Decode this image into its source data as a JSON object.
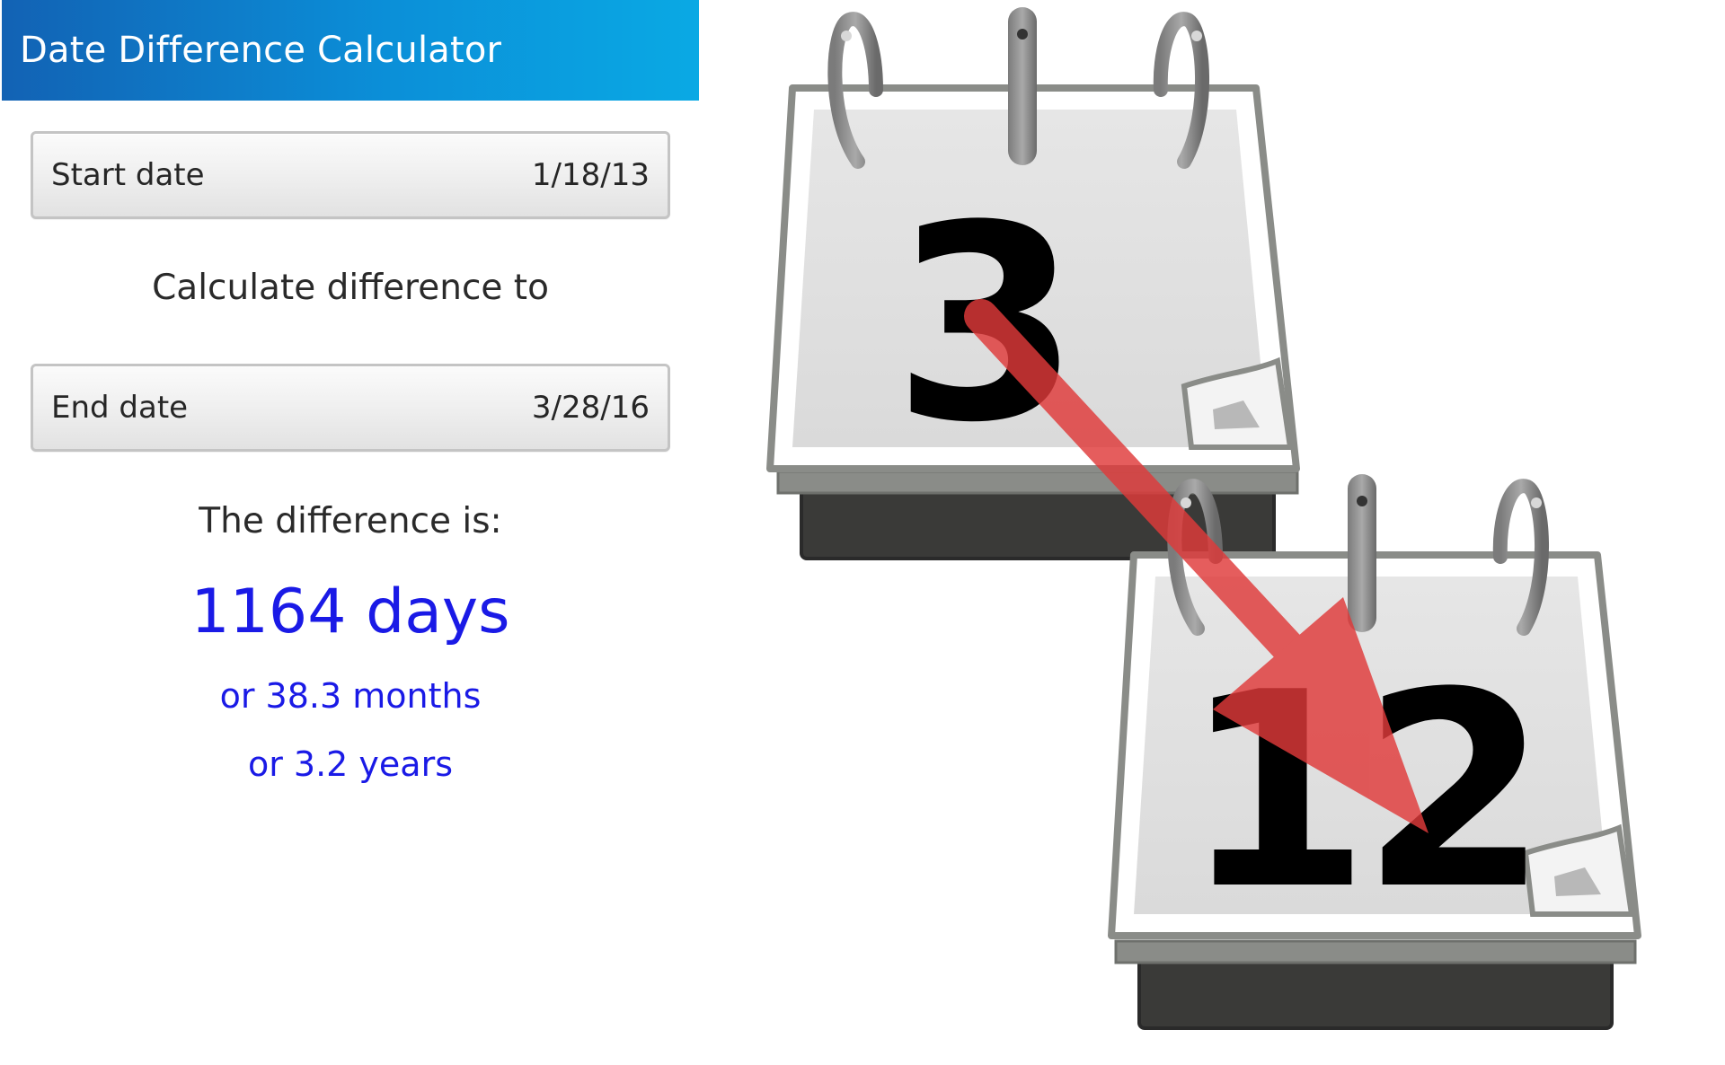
{
  "app": {
    "title": "Date Difference Calculator"
  },
  "start_field": {
    "label": "Start date",
    "value": "1/18/13"
  },
  "middle_label": "Calculate difference to",
  "end_field": {
    "label": "End date",
    "value": "3/28/16"
  },
  "result": {
    "heading": "The difference is:",
    "days": "1164 days",
    "months": "or 38.3 months",
    "years": "or 3.2 years"
  },
  "illustration": {
    "calendar_top_number": "3",
    "calendar_bottom_number": "12",
    "arrow_color": "#e03a3a"
  },
  "colors": {
    "titlebar_start": "#1262b4",
    "titlebar_end": "#0aa9e4",
    "result_blue": "#1a1ae6"
  }
}
